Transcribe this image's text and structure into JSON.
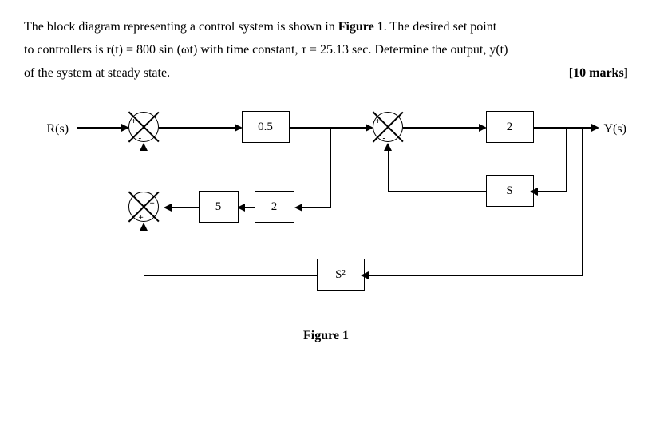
{
  "problem": {
    "line1a": "The block diagram representing a control system is shown in ",
    "fig_ref": "Figure 1",
    "line1b": ". The desired set point",
    "line2": "to controllers is r(t) = 800 sin (ωt) with time constant, τ = 25.13 sec. Determine the output, y(t)",
    "line3_left": "of the system at steady state.",
    "marks": "[10 marks]"
  },
  "diagram": {
    "input": "R(s)",
    "output": "Y(s)",
    "block_05": "0.5",
    "block_2a": "2",
    "block_5": "5",
    "block_2b": "2",
    "block_s": "S",
    "block_s2": "S²",
    "sum1": {
      "left": "+",
      "bottom": "-"
    },
    "sum2": {
      "left": "+",
      "bottom": "-"
    },
    "sum3": {
      "right": "+",
      "bottom": "+"
    },
    "caption": "Figure 1"
  }
}
